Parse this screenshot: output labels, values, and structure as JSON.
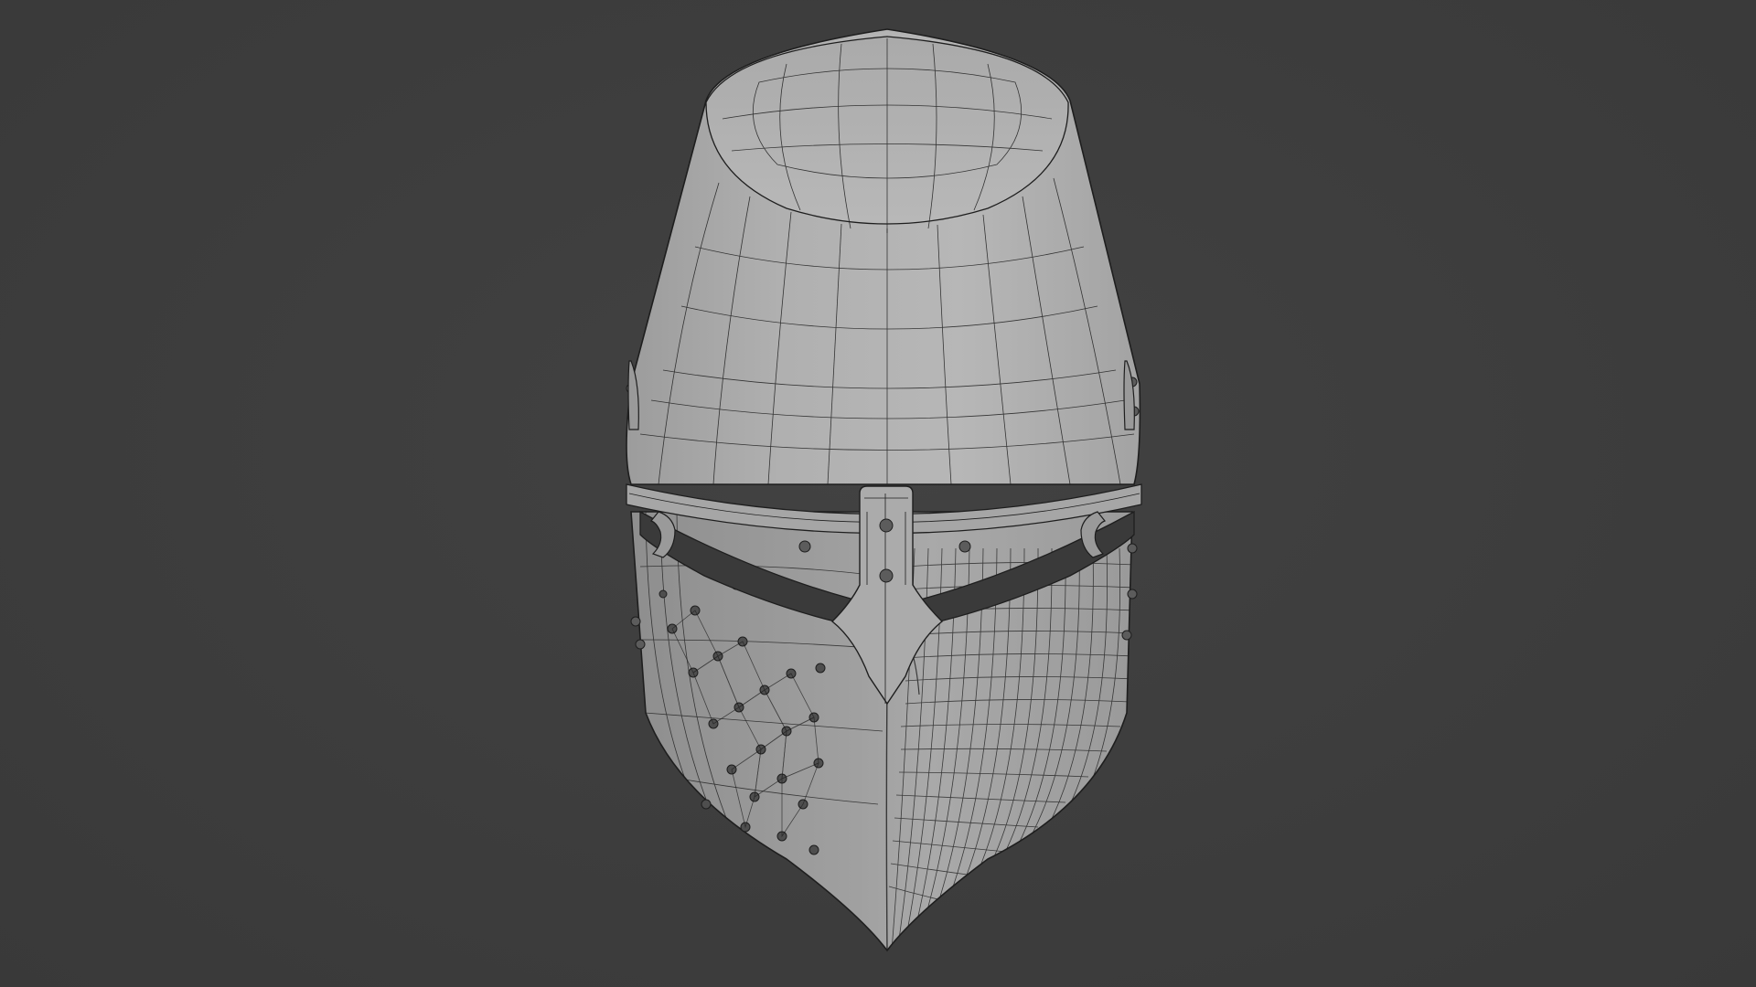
{
  "viewport": {
    "background": "#3d3d3d",
    "subject": "helmet-wireframe-model"
  },
  "colors": {
    "mesh_fill_light": "#b3b3b3",
    "mesh_fill_mid": "#a4a4a4",
    "mesh_fill_dark": "#8c8c8c",
    "wire": "#1e1e1e",
    "rivet": "#5c5c5c"
  }
}
